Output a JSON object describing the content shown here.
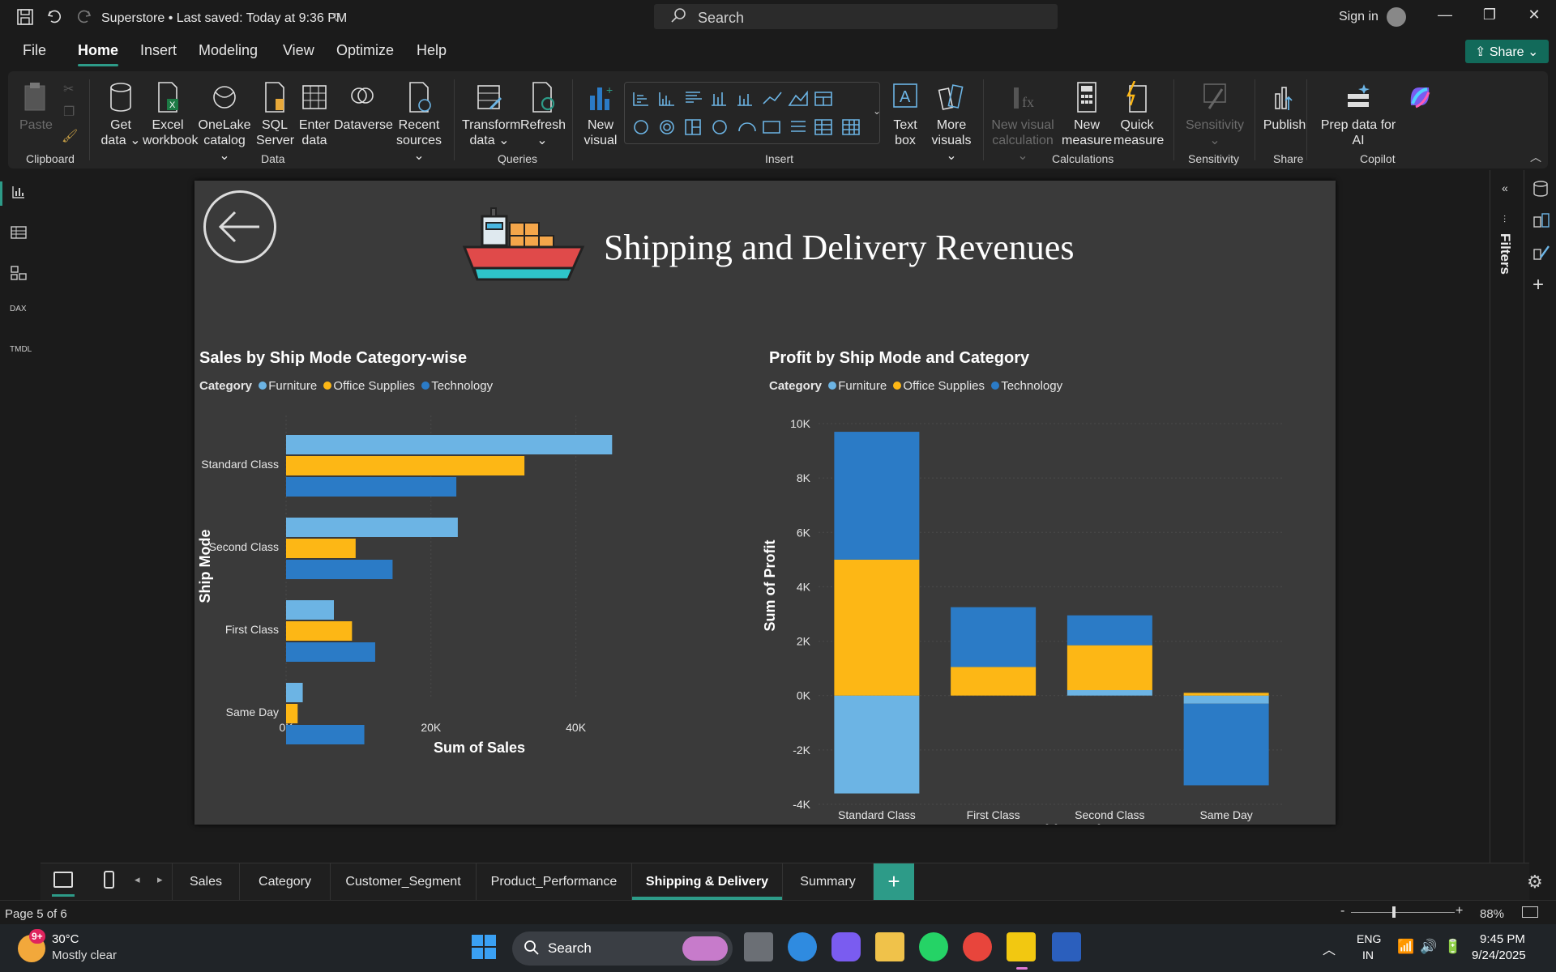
{
  "titlebar": {
    "doc_title": "Superstore • Last saved: Today at 9:36 PM",
    "search": "Search",
    "signin": "Sign in"
  },
  "menu": [
    "File",
    "Home",
    "Insert",
    "Modeling",
    "View",
    "Optimize",
    "Help"
  ],
  "share_label": "Share",
  "ribbon": {
    "paste": "Paste",
    "get_data": "Get data",
    "excel": "Excel workbook",
    "onelake": "OneLake catalog",
    "sql": "SQL Server",
    "enter": "Enter data",
    "dataverse": "Dataverse",
    "recent": "Recent sources",
    "transform": "Transform data",
    "refresh": "Refresh",
    "new_visual": "New visual",
    "text_box": "Text box",
    "more_visuals": "More visuals",
    "new_visual_calc": "New visual calculation",
    "new_measure": "New measure",
    "quick_measure": "Quick measure",
    "sensitivity": "Sensitivity",
    "publish": "Publish",
    "prep_copilot": "Prep data for AI",
    "copilot": "Copilot",
    "groups": {
      "clipboard": "Clipboard",
      "data": "Data",
      "queries": "Queries",
      "insert": "Insert",
      "calculations": "Calculations",
      "sensitivity": "Sensitivity",
      "share": "Share",
      "copilot": "Copilot"
    }
  },
  "report": {
    "title": "Shipping and Delivery Revenues"
  },
  "legend": {
    "label": "Category",
    "items": [
      "Furniture",
      "Office Supplies",
      "Technology"
    ]
  },
  "colors": {
    "furniture": "#6cb4e4",
    "office": "#fdb715",
    "technology": "#2b7bc6",
    "accent": "#2d9b88"
  },
  "chart_data": [
    {
      "type": "bar",
      "orientation": "horizontal",
      "title": "Sales by Ship Mode Category-wise",
      "xlabel": "Sum of Sales",
      "ylabel": "Ship Mode",
      "categories": [
        "Standard Class",
        "Second Class",
        "First Class",
        "Same Day"
      ],
      "xticks": [
        "0K",
        "20K",
        "40K"
      ],
      "xlim": [
        0,
        50000
      ],
      "series": [
        {
          "name": "Furniture",
          "values": [
            45000,
            23700,
            6600,
            2300
          ]
        },
        {
          "name": "Office Supplies",
          "values": [
            32900,
            9600,
            9100,
            1600
          ]
        },
        {
          "name": "Technology",
          "values": [
            23500,
            14700,
            12300,
            10800
          ]
        }
      ]
    },
    {
      "type": "bar",
      "stacked": true,
      "title": "Profit by Ship Mode and Category",
      "xlabel": "Ship Mode",
      "ylabel": "Sum of Profit",
      "categories": [
        "Standard Class",
        "First Class",
        "Second Class",
        "Same Day"
      ],
      "yticks": [
        "10K",
        "8K",
        "6K",
        "4K",
        "2K",
        "0K",
        "-2K",
        "-4K"
      ],
      "ylim": [
        -4000,
        10000
      ],
      "series": [
        {
          "name": "Furniture",
          "values": [
            -3600,
            0,
            200,
            -300
          ]
        },
        {
          "name": "Office Supplies",
          "values": [
            5000,
            1050,
            1650,
            100
          ]
        },
        {
          "name": "Technology",
          "values": [
            4700,
            2200,
            1100,
            -3000
          ]
        }
      ]
    }
  ],
  "tabs": [
    "Sales",
    "Category",
    "Customer_Segment",
    "Product_Performance",
    "Shipping & Delivery",
    "Summary"
  ],
  "active_tab": "Shipping & Delivery",
  "filters_label": "Filters",
  "status": {
    "page": "Page 5 of 6",
    "zoom": "88%"
  },
  "taskbar": {
    "temp": "30°C",
    "weather": "Mostly clear",
    "badge": "9+",
    "search": "Search",
    "lang1": "ENG",
    "lang2": "IN",
    "time": "9:45 PM",
    "date": "9/24/2025"
  }
}
